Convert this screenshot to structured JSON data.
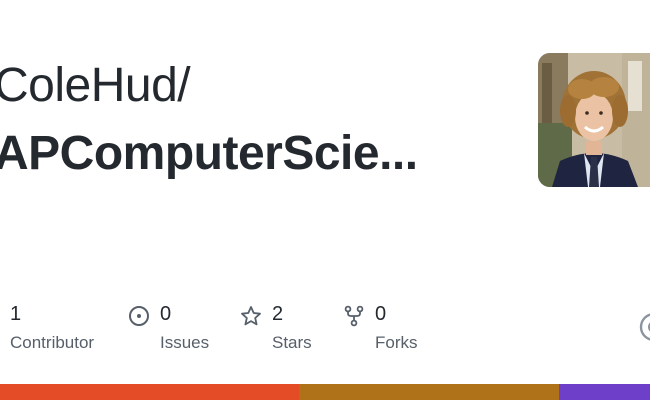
{
  "repo": {
    "owner": "ColeHud/",
    "name": "APComputerScie..."
  },
  "stats": {
    "contributors": {
      "value": "1",
      "label": "Contributor",
      "icon": "people-icon"
    },
    "issues": {
      "value": "0",
      "label": "Issues",
      "icon": "issue-opened-icon"
    },
    "stars": {
      "value": "2",
      "label": "Stars",
      "icon": "star-icon"
    },
    "forks": {
      "value": "0",
      "label": "Forks",
      "icon": "repo-forked-icon"
    }
  },
  "languages": [
    {
      "color": "#e34c26",
      "share": 0.46
    },
    {
      "color": "#b07219",
      "share": 0.4
    },
    {
      "color": "#6e40c9",
      "share": 0.14
    }
  ],
  "colors": {
    "text_primary": "#24292f",
    "text_secondary": "#57606a"
  }
}
